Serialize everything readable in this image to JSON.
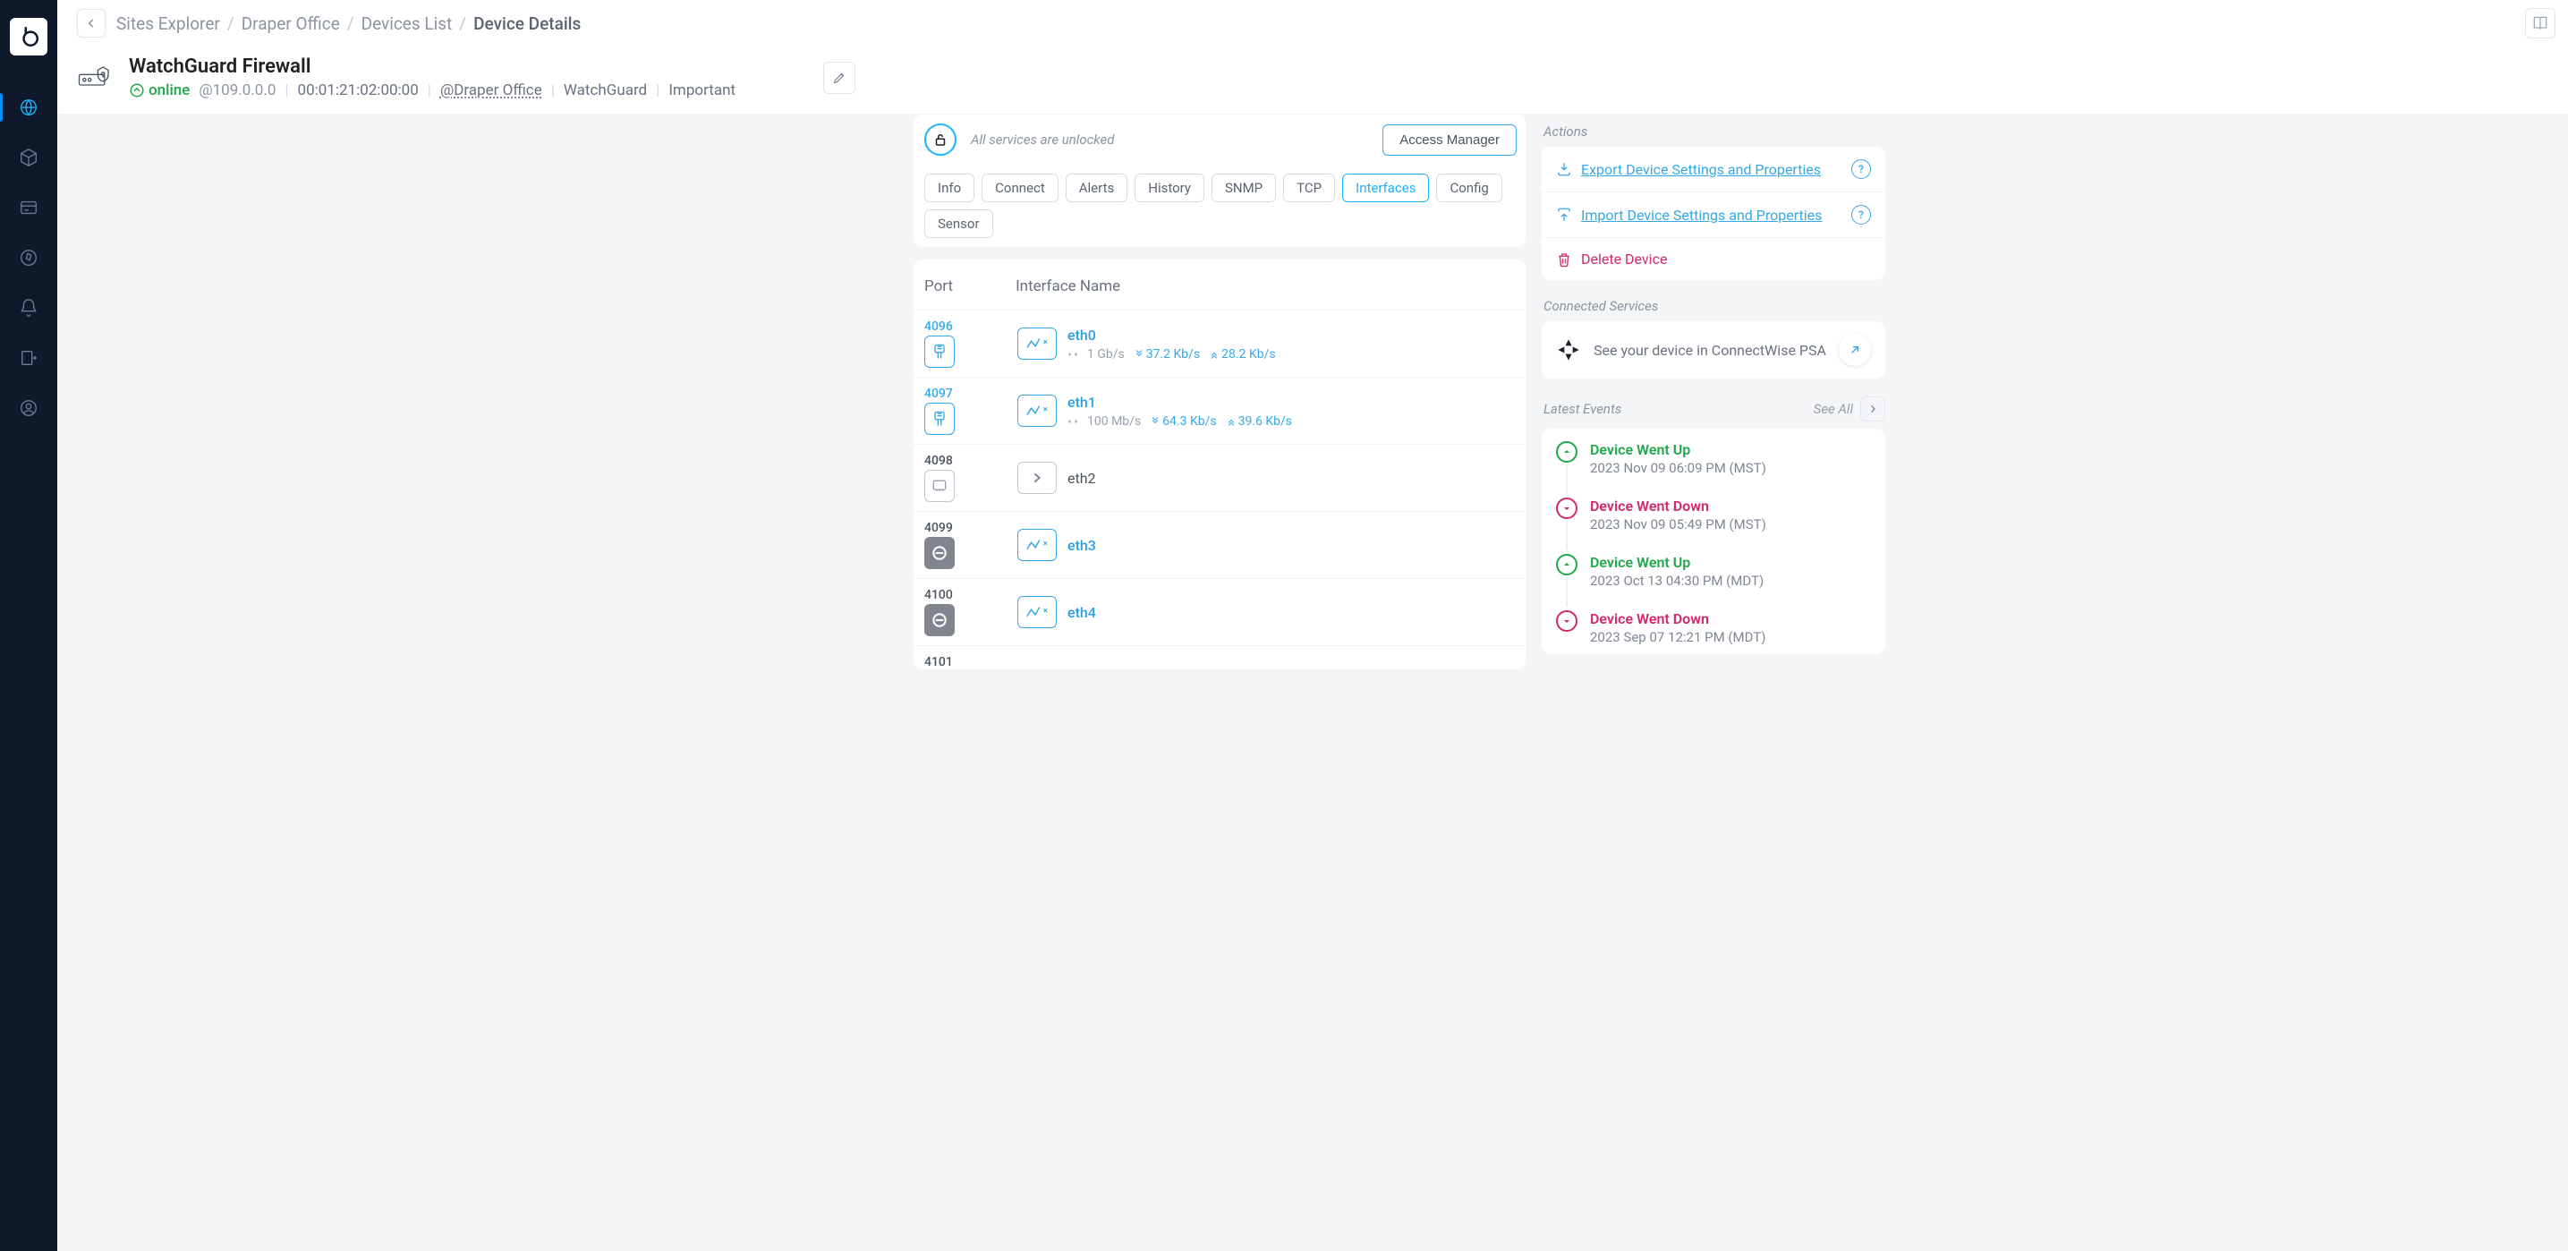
{
  "breadcrumbs": {
    "items": [
      "Sites Explorer",
      "Draper Office",
      "Devices List"
    ],
    "current": "Device Details"
  },
  "device": {
    "name": "WatchGuard Firewall",
    "status": "online",
    "ip": "@109.0.0.0",
    "mac": "00:01:21:02:00:00",
    "site": "Draper Office",
    "vendor": "WatchGuard",
    "importance": "Important"
  },
  "services_banner": {
    "text": "All services are unlocked",
    "btn": "Access Manager"
  },
  "tabs": [
    "Info",
    "Connect",
    "Alerts",
    "History",
    "SNMP",
    "TCP",
    "Interfaces",
    "Config",
    "Sensor"
  ],
  "active_tab_index": 6,
  "iface_header": {
    "port": "Port",
    "name": "Interface Name"
  },
  "interfaces": [
    {
      "port": "4096",
      "name": "eth0",
      "link": "1 Gb/s",
      "down": "37.2 Kb/s",
      "up": "28.2 Kb/s",
      "state": "active"
    },
    {
      "port": "4097",
      "name": "eth1",
      "link": "100 Mb/s",
      "down": "64.3 Kb/s",
      "up": "39.6 Kb/s",
      "state": "active"
    },
    {
      "port": "4098",
      "name": "eth2",
      "link": "",
      "down": "",
      "up": "",
      "state": "empty"
    },
    {
      "port": "4099",
      "name": "eth3",
      "link": "",
      "down": "",
      "up": "",
      "state": "disabled"
    },
    {
      "port": "4100",
      "name": "eth4",
      "link": "",
      "down": "",
      "up": "",
      "state": "disabled"
    },
    {
      "port": "4101",
      "name": "",
      "link": "",
      "down": "",
      "up": "",
      "state": "cut"
    }
  ],
  "side": {
    "actions_label": "Actions",
    "actions": {
      "export": "Export Device Settings and Properties",
      "import": "Import Device Settings and Properties",
      "delete": "Delete Device"
    },
    "connected_label": "Connected Services",
    "connected_text": "See your device in ConnectWise PSA",
    "events_label": "Latest Events",
    "see_all": "See All",
    "events": [
      {
        "kind": "up",
        "title": "Device Went Up",
        "time": "2023 Nov 09 06:09 PM (MST)"
      },
      {
        "kind": "down",
        "title": "Device Went Down",
        "time": "2023 Nov 09 05:49 PM (MST)"
      },
      {
        "kind": "up",
        "title": "Device Went Up",
        "time": "2023 Oct 13 04:30 PM (MDT)"
      },
      {
        "kind": "down",
        "title": "Device Went Down",
        "time": "2023 Sep 07 12:21 PM (MDT)"
      }
    ]
  }
}
